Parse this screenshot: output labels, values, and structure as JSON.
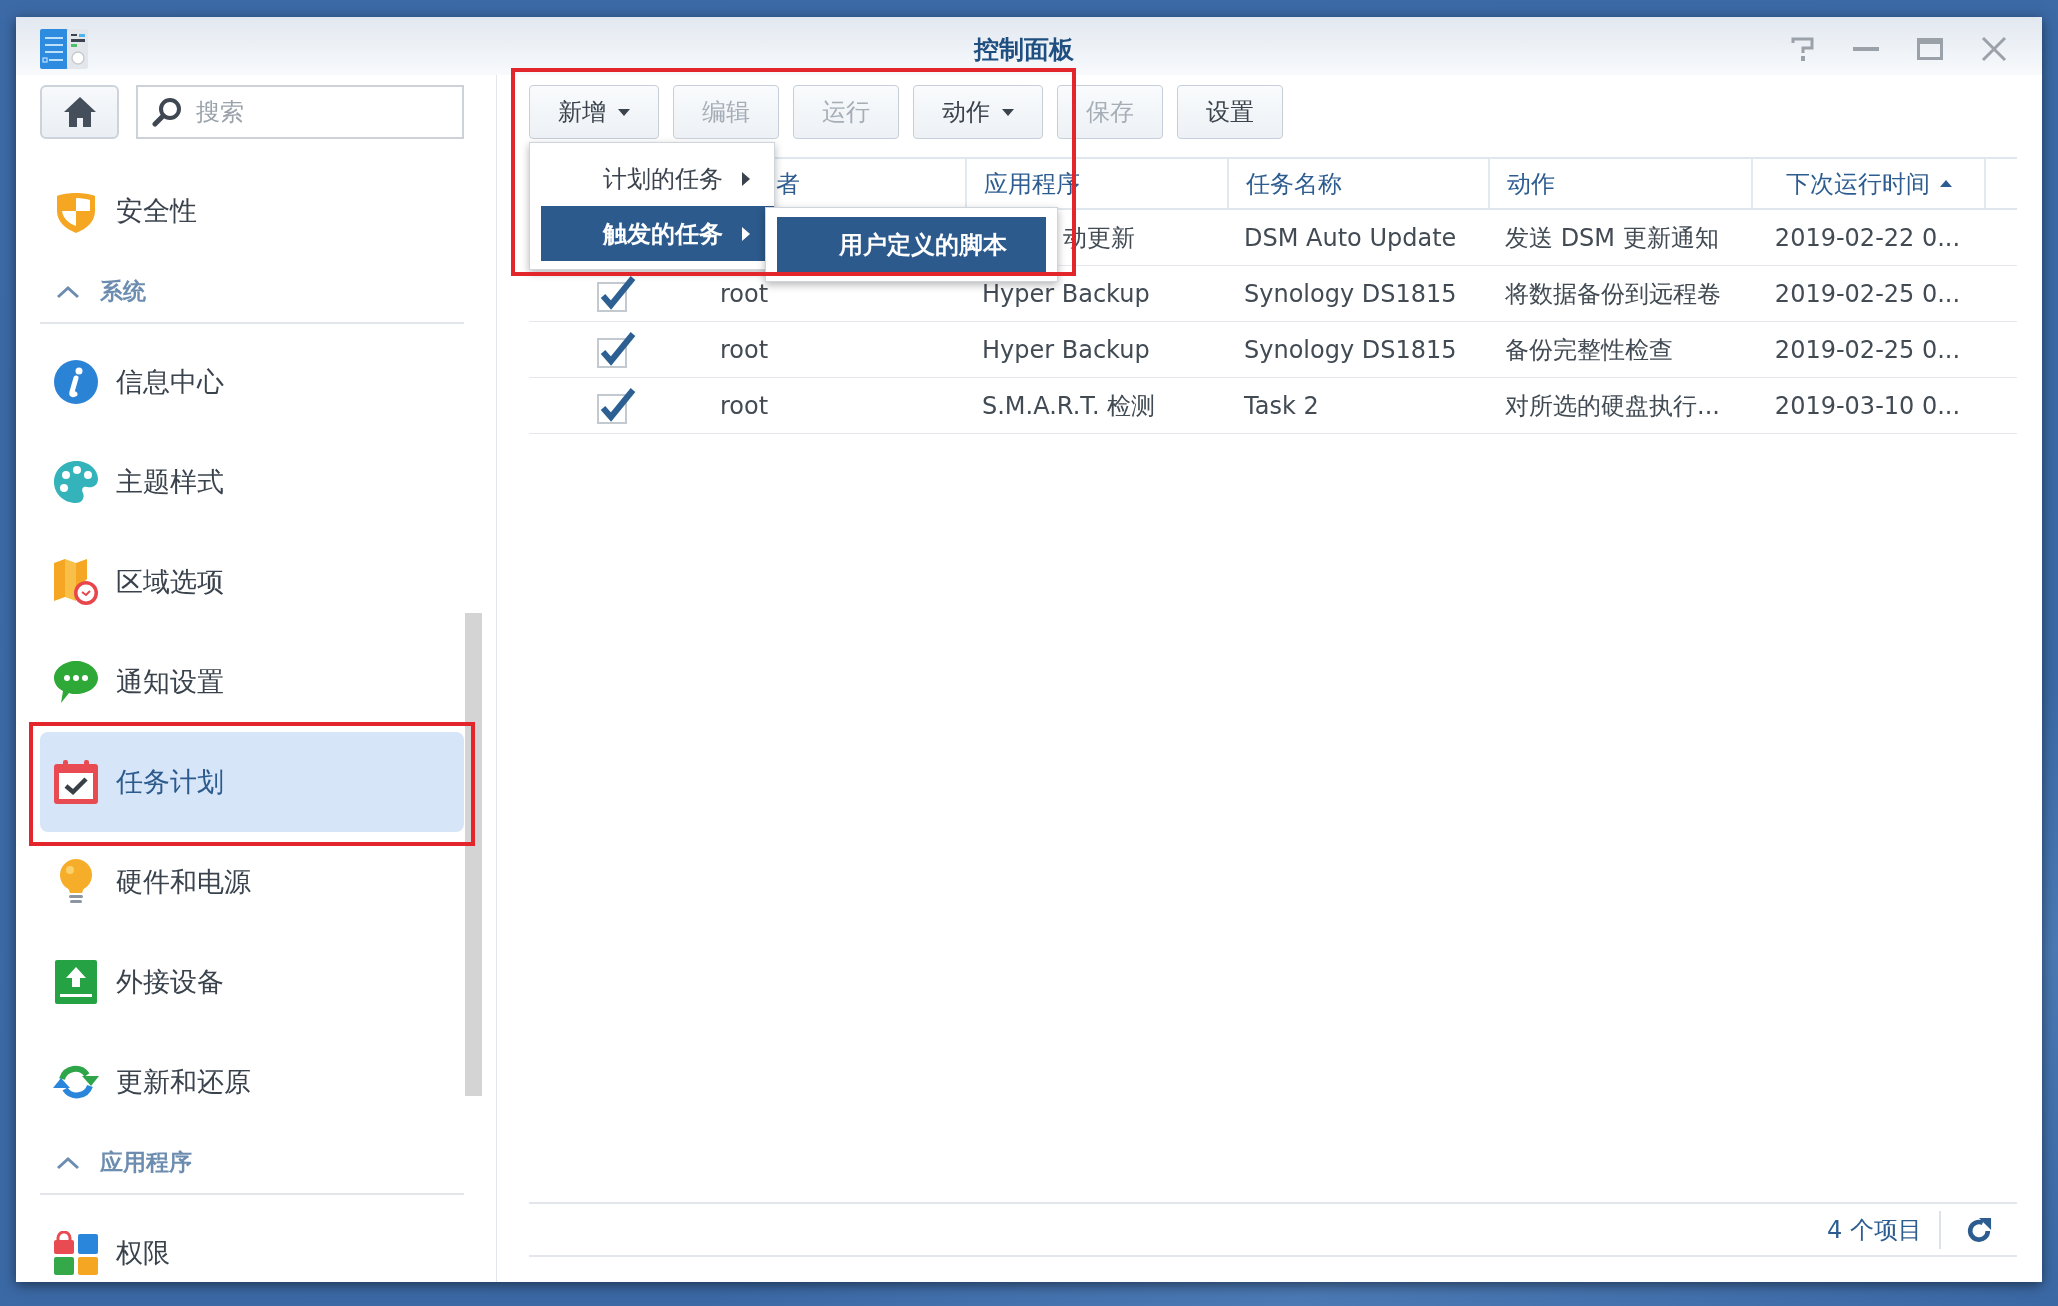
{
  "window": {
    "title": "控制面板"
  },
  "sidebar": {
    "search": {
      "placeholder": "搜索"
    },
    "items": [
      {
        "label": "安全性",
        "selected": false,
        "highlighted": false
      }
    ],
    "sections": [
      {
        "title": "系统",
        "expanded": true,
        "items": [
          {
            "label": "信息中心",
            "selected": false,
            "highlighted": false
          },
          {
            "label": "主题样式",
            "selected": false,
            "highlighted": false
          },
          {
            "label": "区域选项",
            "selected": false,
            "highlighted": false
          },
          {
            "label": "通知设置",
            "selected": false,
            "highlighted": false
          },
          {
            "label": "任务计划",
            "selected": true,
            "highlighted": true
          },
          {
            "label": "硬件和电源",
            "selected": false,
            "highlighted": false
          },
          {
            "label": "外接设备",
            "selected": false,
            "highlighted": false
          },
          {
            "label": "更新和还原",
            "selected": false,
            "highlighted": false
          }
        ]
      },
      {
        "title": "应用程序",
        "expanded": true,
        "items": [
          {
            "label": "权限",
            "selected": false,
            "highlighted": false
          }
        ]
      }
    ]
  },
  "toolbar": {
    "highlighted": true,
    "buttons": [
      {
        "label": "新增",
        "dropdown": true,
        "disabled": false,
        "menu": {
          "items": [
            {
              "label": "计划的任务",
              "has_submenu": true,
              "selected": false
            },
            {
              "label": "触发的任务",
              "has_submenu": true,
              "selected": true,
              "submenu": {
                "items": [
                  {
                    "label": "用户定义的脚本",
                    "selected": true
                  }
                ]
              }
            }
          ]
        }
      },
      {
        "label": "编辑",
        "dropdown": false,
        "disabled": true
      },
      {
        "label": "运行",
        "dropdown": false,
        "disabled": true
      },
      {
        "label": "动作",
        "dropdown": true,
        "disabled": false
      },
      {
        "label": "保存",
        "dropdown": false,
        "disabled": true
      },
      {
        "label": "设置",
        "dropdown": false,
        "disabled": false
      }
    ]
  },
  "table": {
    "columns": [
      {
        "label": "者"
      },
      {
        "label": "应用程序"
      },
      {
        "label": "任务名称"
      },
      {
        "label": "动作"
      },
      {
        "label": "下次运行时间",
        "sorted": true,
        "descending": false
      }
    ],
    "rows": [
      {
        "application": "动更新",
        "task_name": "DSM Auto Update",
        "action": "发送 DSM 更新通知",
        "next_run_time": "2019-02-22 0..."
      },
      {
        "checked": true,
        "column_2": "root",
        "application": "Hyper Backup",
        "task_name": "Synology DS1815",
        "action": "将数据备份到远程卷",
        "next_run_time": "2019-02-25 0..."
      },
      {
        "checked": true,
        "column_2": "root",
        "application": "Hyper Backup",
        "task_name": "Synology DS1815",
        "action": "备份完整性检查",
        "next_run_time": "2019-02-25 0..."
      },
      {
        "checked": true,
        "column_2": "root",
        "application": "S.M.A.R.T. 检测",
        "task_name": "Task 2",
        "action": "对所选的硬盘执行...",
        "next_run_time": "2019-03-10 0..."
      }
    ]
  },
  "status_bar": {
    "count": "4 个项目"
  }
}
